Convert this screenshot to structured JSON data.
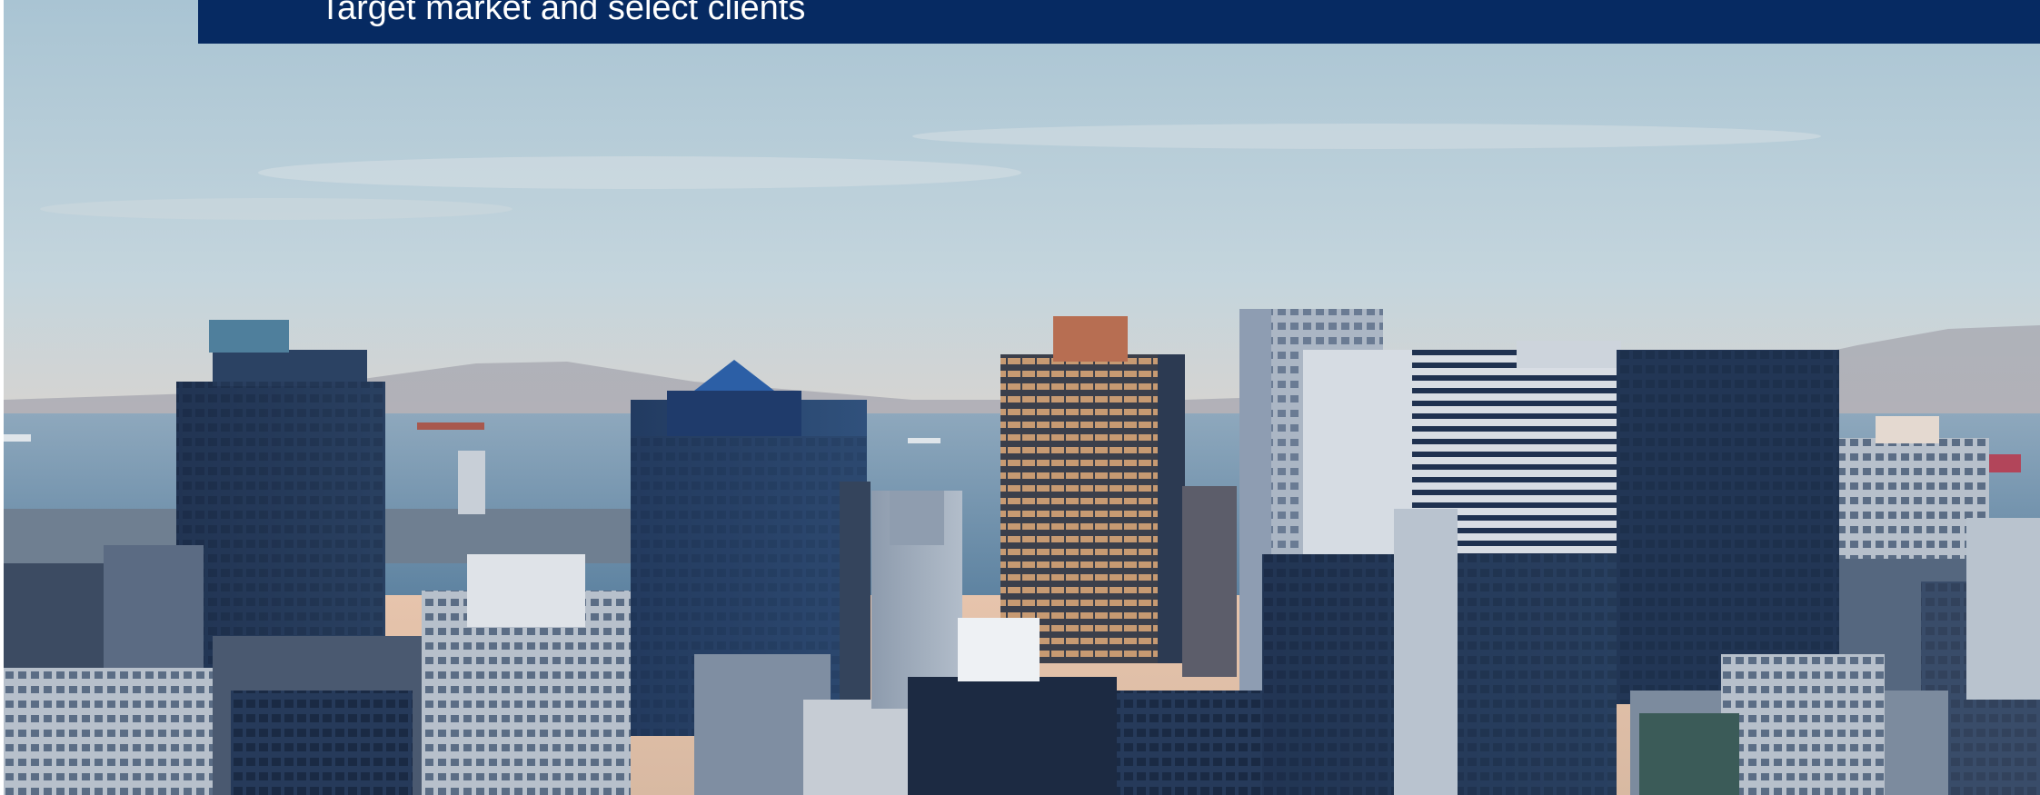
{
  "slide": {
    "title": "Target market and select clients"
  },
  "colors": {
    "banner": "#062a62",
    "sky_top": "#b8cdd9",
    "sky_horizon": "#e6c3a8",
    "water": "#6f91ab"
  },
  "image": {
    "icon": "city-skyline-photo"
  }
}
